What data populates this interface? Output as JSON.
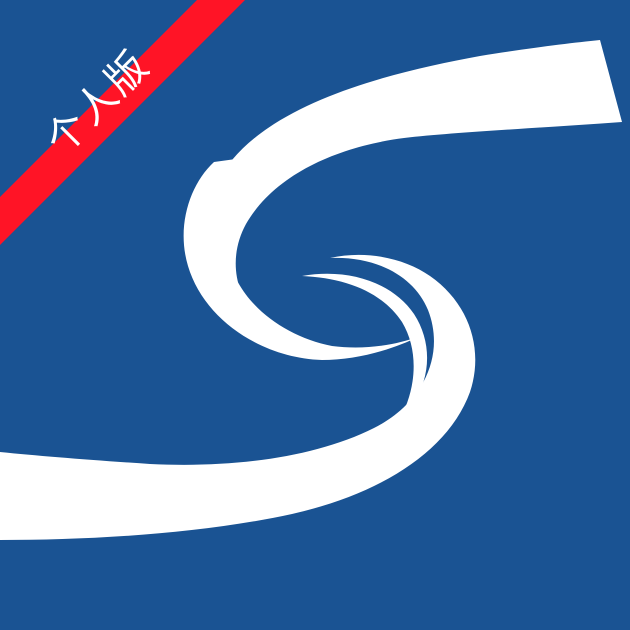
{
  "app_icon": {
    "badge_label": "个人版",
    "icon_name": "swirl-logo-icon"
  },
  "colors": {
    "background": "#1A5393",
    "swirl": "#FFFFFF",
    "badge_fill": "#FF1426",
    "badge_text": "#FFFFFF"
  }
}
